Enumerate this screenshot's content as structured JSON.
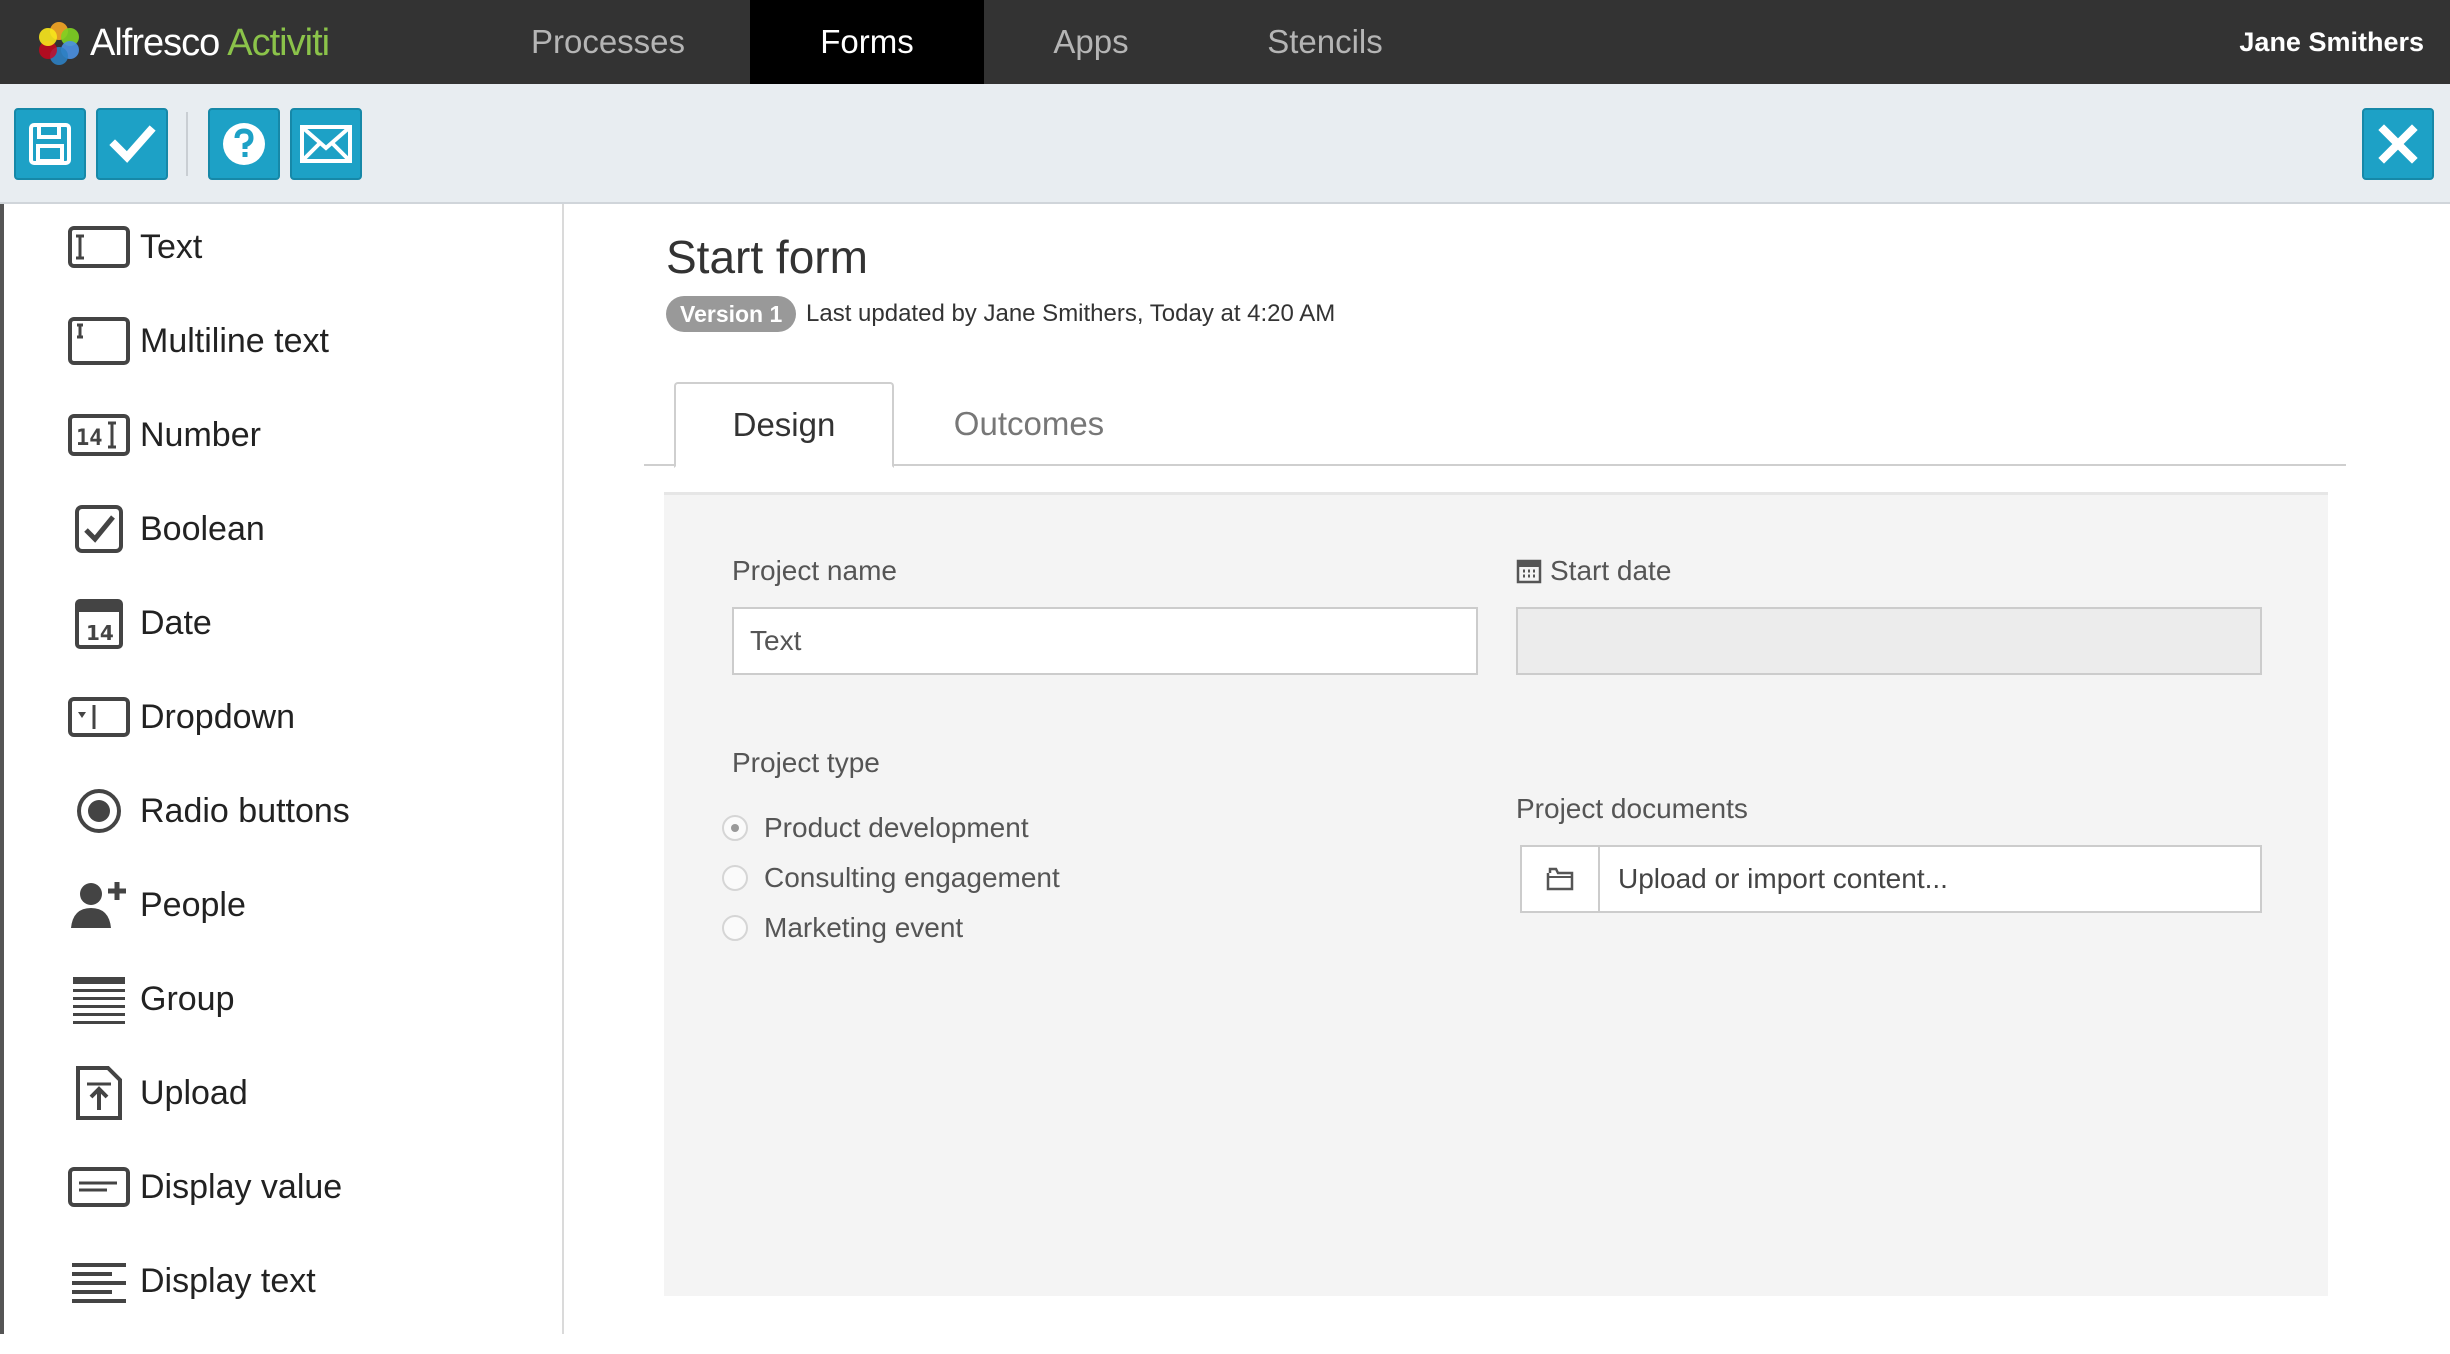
{
  "header": {
    "logo_primary": "Alfresco",
    "logo_secondary": "Activiti",
    "nav": [
      {
        "label": "Processes",
        "active": false
      },
      {
        "label": "Forms",
        "active": true
      },
      {
        "label": "Apps",
        "active": false
      },
      {
        "label": "Stencils",
        "active": false
      }
    ],
    "user": "Jane Smithers"
  },
  "toolbar": {
    "buttons": [
      "save-icon",
      "checkmark-icon",
      "help-icon",
      "mail-icon"
    ],
    "close": "close-icon",
    "accent_color": "#1da1c6"
  },
  "palette": {
    "items": [
      {
        "label": "Text",
        "icon": "text-field-icon"
      },
      {
        "label": "Multiline text",
        "icon": "multiline-text-icon"
      },
      {
        "label": "Number",
        "icon": "number-icon"
      },
      {
        "label": "Boolean",
        "icon": "checkbox-icon"
      },
      {
        "label": "Date",
        "icon": "calendar-icon"
      },
      {
        "label": "Dropdown",
        "icon": "dropdown-icon"
      },
      {
        "label": "Radio buttons",
        "icon": "radio-icon"
      },
      {
        "label": "People",
        "icon": "person-add-icon"
      },
      {
        "label": "Group",
        "icon": "group-icon"
      },
      {
        "label": "Upload",
        "icon": "upload-icon"
      },
      {
        "label": "Display value",
        "icon": "display-value-icon"
      },
      {
        "label": "Display text",
        "icon": "display-text-icon"
      }
    ]
  },
  "form": {
    "title": "Start form",
    "version": "Version 1",
    "last_updated": "Last updated by Jane Smithers, Today at 4:20 AM",
    "tabs": [
      {
        "label": "Design",
        "active": true
      },
      {
        "label": "Outcomes",
        "active": false
      }
    ],
    "fields": {
      "project_name": {
        "label": "Project name",
        "value": "Text"
      },
      "start_date": {
        "label": "Start date",
        "value": ""
      },
      "project_type": {
        "label": "Project type",
        "options": [
          {
            "label": "Product development",
            "checked": true
          },
          {
            "label": "Consulting engagement",
            "checked": false
          },
          {
            "label": "Marketing event",
            "checked": false
          }
        ]
      },
      "project_documents": {
        "label": "Project documents",
        "placeholder": "Upload or import content..."
      }
    }
  }
}
